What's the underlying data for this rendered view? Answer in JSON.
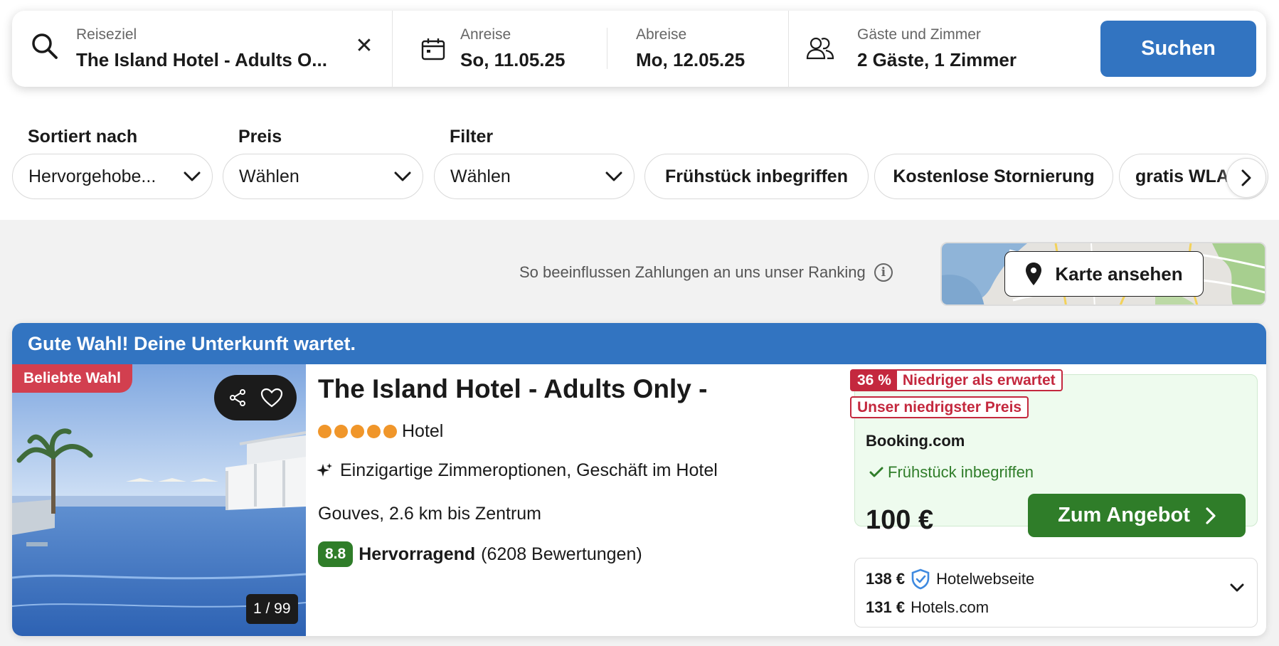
{
  "search": {
    "destination_label": "Reiseziel",
    "destination_value": "The Island Hotel - Adults O...",
    "clear_symbol": "✕",
    "checkin_label": "Anreise",
    "checkin_value": "So, 11.05.25",
    "checkout_label": "Abreise",
    "checkout_value": "Mo, 12.05.25",
    "guests_label": "Gäste und Zimmer",
    "guests_value": "2 Gäste, 1 Zimmer",
    "submit_label": "Suchen"
  },
  "filters": {
    "sort_heading": "Sortiert nach",
    "sort_value": "Hervorgehobe...",
    "price_heading": "Preis",
    "price_value": "Wählen",
    "filter_heading": "Filter",
    "filter_value": "Wählen",
    "chips": [
      "Frühstück inbegriffen",
      "Kostenlose Stornierung",
      "gratis WLAN"
    ]
  },
  "ranking": {
    "text": "So beeinflussen Zahlungen an uns unser Ranking",
    "info_symbol": "i"
  },
  "map": {
    "button_label": "Karte ansehen"
  },
  "card": {
    "banner": "Gute Wahl! Deine Unterkunft wartet.",
    "badge": "Beliebte Wahl",
    "photo_counter": "1 / 99",
    "title": "The Island Hotel - Adults Only -",
    "star_count": 5,
    "type": "Hotel",
    "features": "Einzigartige Zimmeroptionen, Geschäft im Hotel",
    "location": "Gouves, 2.6 km bis Zentrum",
    "score": "8.8",
    "rating_word": "Hervorragend",
    "rating_count": "(6208 Bewertungen)",
    "deal": {
      "discount_pct": "36 %",
      "discount_text": "Niedriger als erwartet",
      "lowest_tag": "Unser niedrigster Preis",
      "provider": "Booking.com",
      "breakfast": "Frühstück inbegriffen",
      "price": "100 €",
      "button_label": "Zum Angebot"
    },
    "alternatives": [
      {
        "price": "138 €",
        "provider": "Hotelwebseite",
        "verified": true
      },
      {
        "price": "131 €",
        "provider": "Hotels.com",
        "verified": false
      }
    ]
  },
  "colors": {
    "primary_blue": "#3274c1",
    "deal_green": "#2f7d29",
    "popular_red": "#d23f4f",
    "discount_red": "#c4283e",
    "star_orange": "#f0962a"
  }
}
